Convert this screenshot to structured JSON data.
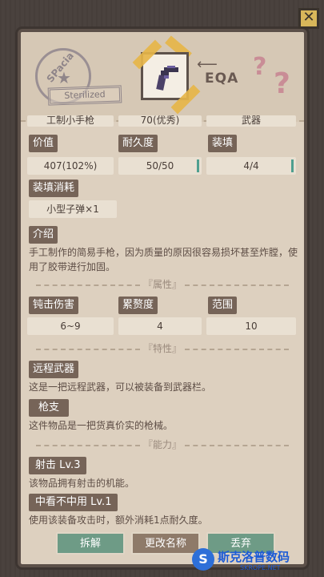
{
  "close_icon": "close-x-icon",
  "header": {
    "stamp_circle_text": "SPacia",
    "stamp_rect_text": "Sterilized",
    "eqa_text": "EQA",
    "question_marks": [
      "?",
      "?"
    ],
    "item_icon": "pistol-icon"
  },
  "partial_row": [
    "工制小手枪",
    "70(优秀)",
    "武器"
  ],
  "stats_row1": {
    "labels": [
      "价值",
      "耐久度",
      "装填"
    ],
    "values": [
      "407(102%)",
      "50/50",
      "4/4"
    ]
  },
  "ammo": {
    "label": "装填消耗",
    "value": "小型子弹×1"
  },
  "intro": {
    "label": "介绍",
    "text": "手工制作的简易手枪，因为质量的原因很容易损坏甚至炸膛，使用了胶带进行加固。"
  },
  "attributes": {
    "title": "『属性』",
    "labels": [
      "钝击伤害",
      "累赘度",
      "范围"
    ],
    "values": [
      "6~9",
      "4",
      "10"
    ]
  },
  "traits": {
    "title": "『特性』",
    "items": [
      {
        "name": "远程武器",
        "desc": "这是一把远程武器，可以被装备到武器栏。"
      },
      {
        "name": "枪支",
        "desc": "这件物品是一把货真价实的枪械。"
      }
    ]
  },
  "abilities": {
    "title": "『能力』",
    "items": [
      {
        "name": "射击 Lv.3",
        "desc": "该物品拥有射击的机能。"
      },
      {
        "name": "中看不中用 Lv.1",
        "desc": "使用该装备攻击时，额外消耗1点耐久度。"
      }
    ]
  },
  "buttons": [
    "拆解",
    "更改名称",
    "丢弃"
  ],
  "watermark": {
    "text": "斯克洛普数码",
    "sub": "SKROPE.NET"
  }
}
